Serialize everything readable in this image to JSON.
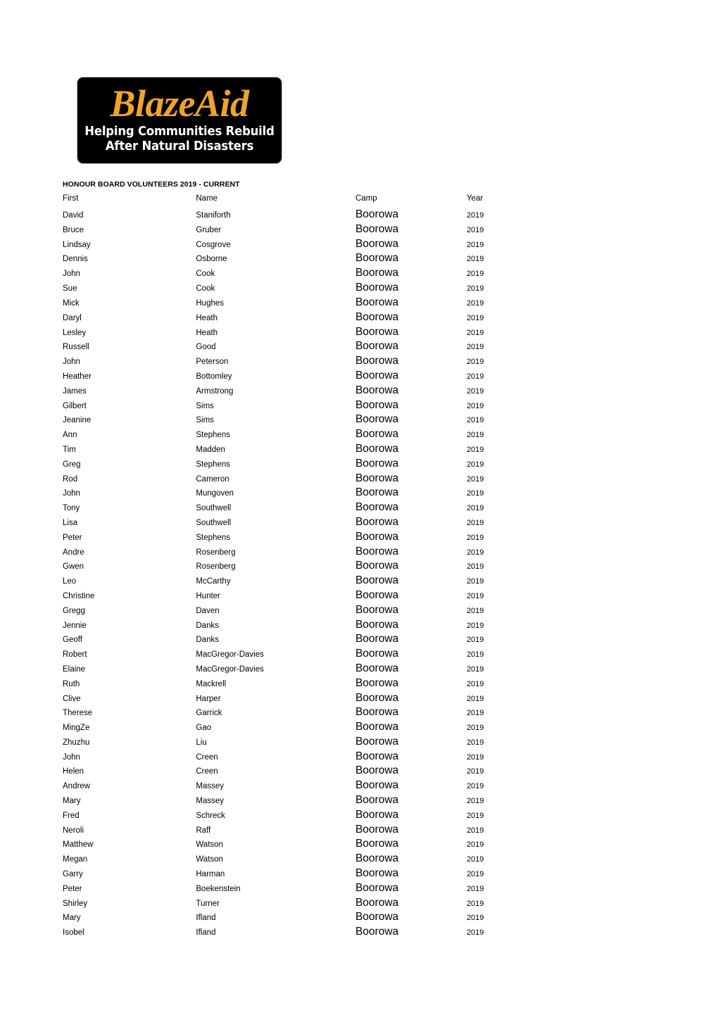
{
  "logo": {
    "name": "blazeaid-logo",
    "wordmark": "BlazeAid",
    "tagline_line1": "Helping Communities Rebuild",
    "tagline_line2": "After Natural Disasters",
    "background_color": "#000000",
    "wordmark_color": "#F0A32A",
    "tagline_color": "#FFFFFF"
  },
  "document": {
    "title": "HONOUR BOARD VOLUNTEERS 2019 - CURRENT"
  },
  "table": {
    "columns": [
      "First",
      "Name",
      "Camp",
      "Year"
    ],
    "rows": [
      [
        "David",
        "Staniforth",
        "Boorowa",
        "2019"
      ],
      [
        "Bruce",
        "Gruber",
        "Boorowa",
        "2019"
      ],
      [
        "Lindsay",
        "Cosgrove",
        "Boorowa",
        "2019"
      ],
      [
        "Dennis",
        "Osborne",
        "Boorowa",
        "2019"
      ],
      [
        "John",
        "Cook",
        "Boorowa",
        "2019"
      ],
      [
        "Sue",
        "Cook",
        "Boorowa",
        "2019"
      ],
      [
        "Mick",
        "Hughes",
        "Boorowa",
        "2019"
      ],
      [
        "Daryl",
        "Heath",
        "Boorowa",
        "2019"
      ],
      [
        "Lesley",
        "Heath",
        "Boorowa",
        "2019"
      ],
      [
        "Russell",
        "Good",
        "Boorowa",
        "2019"
      ],
      [
        "John",
        "Peterson",
        "Boorowa",
        "2019"
      ],
      [
        "Heather",
        "Bottomley",
        "Boorowa",
        "2019"
      ],
      [
        "James",
        "Armstrong",
        "Boorowa",
        "2019"
      ],
      [
        "Gilbert",
        "Sims",
        "Boorowa",
        "2019"
      ],
      [
        "Jeanine",
        "Sims",
        "Boorowa",
        "2019"
      ],
      [
        "Ann",
        "Stephens",
        "Boorowa",
        "2019"
      ],
      [
        "Tim",
        "Madden",
        "Boorowa",
        "2019"
      ],
      [
        "Greg",
        "Stephens",
        "Boorowa",
        "2019"
      ],
      [
        "Rod",
        "Cameron",
        "Boorowa",
        "2019"
      ],
      [
        "John",
        "Mungoven",
        "Boorowa",
        "2019"
      ],
      [
        "Tony",
        "Southwell",
        "Boorowa",
        "2019"
      ],
      [
        "Lisa",
        "Southwell",
        "Boorowa",
        "2019"
      ],
      [
        "Peter",
        "Stephens",
        "Boorowa",
        "2019"
      ],
      [
        "Andre",
        "Rosenberg",
        "Boorowa",
        "2019"
      ],
      [
        "Gwen",
        "Rosenberg",
        "Boorowa",
        "2019"
      ],
      [
        "Leo",
        "McCarthy",
        "Boorowa",
        "2019"
      ],
      [
        "Christine",
        "Hunter",
        "Boorowa",
        "2019"
      ],
      [
        "Gregg",
        "Daven",
        "Boorowa",
        "2019"
      ],
      [
        "Jennie",
        "Danks",
        "Boorowa",
        "2019"
      ],
      [
        "Geoff",
        "Danks",
        "Boorowa",
        "2019"
      ],
      [
        "Robert",
        "MacGregor-Davies",
        "Boorowa",
        "2019"
      ],
      [
        "Elaine",
        "MacGregor-Davies",
        "Boorowa",
        "2019"
      ],
      [
        "Ruth",
        "Mackrell",
        "Boorowa",
        "2019"
      ],
      [
        "Clive",
        "Harper",
        "Boorowa",
        "2019"
      ],
      [
        "Therese",
        "Garrick",
        "Boorowa",
        "2019"
      ],
      [
        "MingZe",
        "Gao",
        "Boorowa",
        "2019"
      ],
      [
        "Zhuzhu",
        "Liu",
        "Boorowa",
        "2019"
      ],
      [
        "John",
        "Creen",
        "Boorowa",
        "2019"
      ],
      [
        "Helen",
        "Creen",
        "Boorowa",
        "2019"
      ],
      [
        "Andrew",
        "Massey",
        "Boorowa",
        "2019"
      ],
      [
        "Mary",
        "Massey",
        "Boorowa",
        "2019"
      ],
      [
        "Fred",
        "Schreck",
        "Boorowa",
        "2019"
      ],
      [
        "Neroli",
        "Raff",
        "Boorowa",
        "2019"
      ],
      [
        "Matthew",
        "Watson",
        "Boorowa",
        "2019"
      ],
      [
        "Megan",
        "Watson",
        "Boorowa",
        "2019"
      ],
      [
        "Garry",
        "Harman",
        "Boorowa",
        "2019"
      ],
      [
        "Peter",
        "Boekenstein",
        "Boorowa",
        "2019"
      ],
      [
        "Shirley",
        "Turner",
        "Boorowa",
        "2019"
      ],
      [
        "Mary",
        "Ifland",
        "Boorowa",
        "2019"
      ],
      [
        "Isobel",
        "Ifland",
        "Boorowa",
        "2019"
      ]
    ]
  }
}
